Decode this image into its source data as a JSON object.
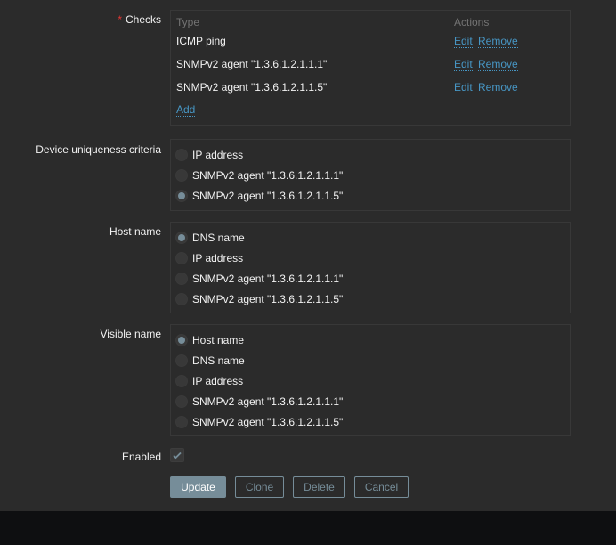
{
  "checks": {
    "label": "Checks",
    "required_mark": "*",
    "col_type": "Type",
    "col_actions": "Actions",
    "rows": [
      {
        "type": "ICMP ping",
        "edit": "Edit",
        "remove": "Remove"
      },
      {
        "type": "SNMPv2 agent \"1.3.6.1.2.1.1.1\"",
        "edit": "Edit",
        "remove": "Remove"
      },
      {
        "type": "SNMPv2 agent \"1.3.6.1.2.1.1.5\"",
        "edit": "Edit",
        "remove": "Remove"
      }
    ],
    "add": "Add"
  },
  "uniqueness": {
    "label": "Device uniqueness criteria",
    "options": [
      "IP address",
      "SNMPv2 agent \"1.3.6.1.2.1.1.1\"",
      "SNMPv2 agent \"1.3.6.1.2.1.1.5\""
    ],
    "selected": 2
  },
  "host_name": {
    "label": "Host name",
    "options": [
      "DNS name",
      "IP address",
      "SNMPv2 agent \"1.3.6.1.2.1.1.1\"",
      "SNMPv2 agent \"1.3.6.1.2.1.1.5\""
    ],
    "selected": 0
  },
  "visible_name": {
    "label": "Visible name",
    "options": [
      "Host name",
      "DNS name",
      "IP address",
      "SNMPv2 agent \"1.3.6.1.2.1.1.1\"",
      "SNMPv2 agent \"1.3.6.1.2.1.1.5\""
    ],
    "selected": 0
  },
  "enabled": {
    "label": "Enabled",
    "checked": true
  },
  "buttons": {
    "update": "Update",
    "clone": "Clone",
    "delete": "Delete",
    "cancel": "Cancel"
  }
}
